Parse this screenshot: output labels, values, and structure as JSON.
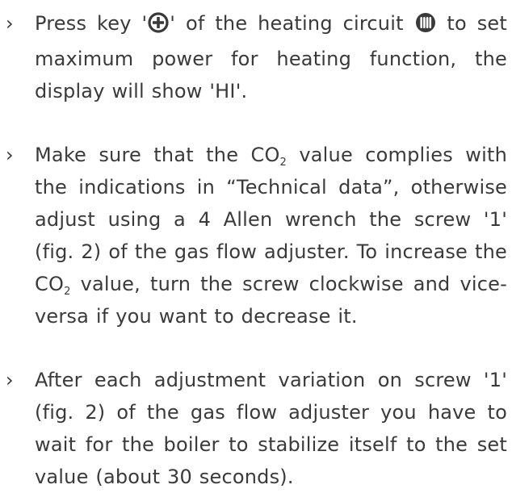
{
  "bullet_symbol": "›",
  "item1": {
    "t1": "Press key ",
    "q_open": "'",
    "plus_icon": "plus-circle-icon",
    "q_close": "'",
    "t2": " of the heating circuit ",
    "radiator_icon": "radiator-icon",
    "t3": " to set maximum power for heating function, the display will show 'HI'."
  },
  "item2": {
    "t1": "Make sure that the CO",
    "sub1": "2",
    "t2": " value complies with the indications in “Technical data”, otherwise adjust using a 4 Allen wrench the screw '1' (fig. 2) of the gas flow adjuster. To increase the CO",
    "sub2": "2",
    "t3": " value, turn the screw clockwise and vice-versa if you want to decrease it."
  },
  "item3": {
    "text": "After each adjustment variation on screw '1' (fig. 2) of the gas flow adjuster you have to wait for the boiler to stabilize itself to the set value (about 30 seconds)."
  }
}
